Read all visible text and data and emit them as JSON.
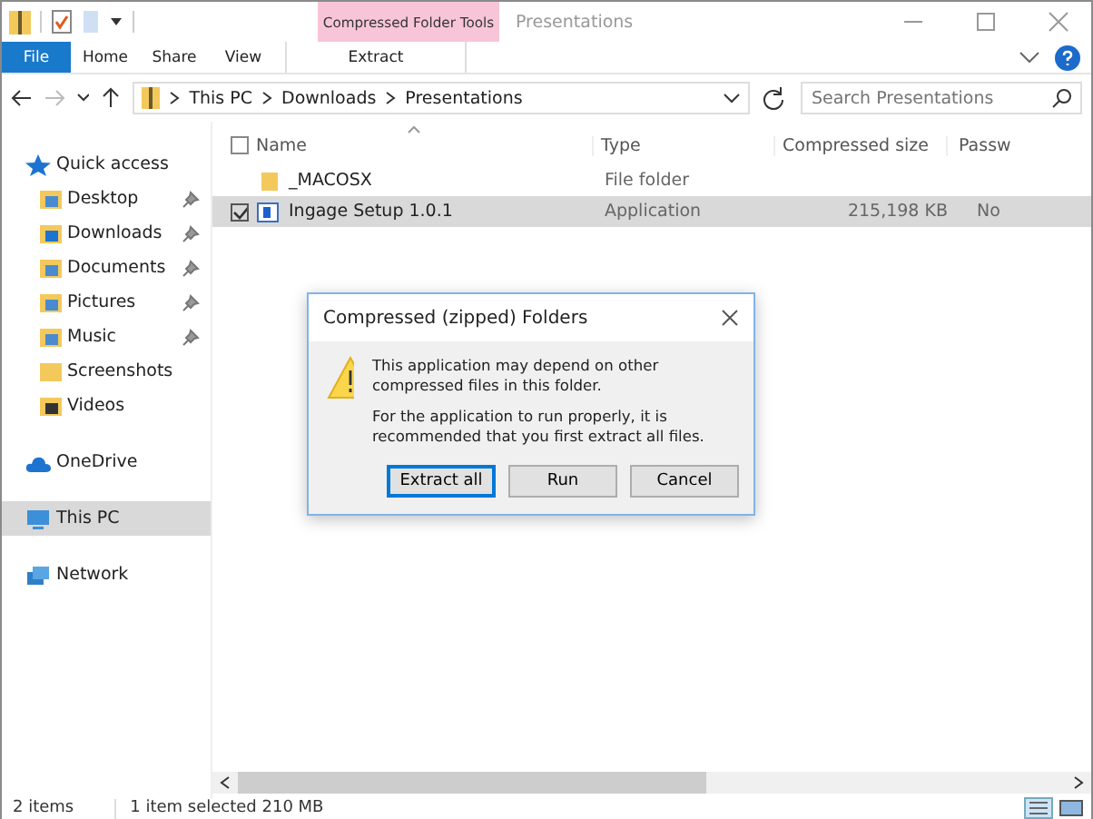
{
  "title_bar": {
    "contextual_tab": "Compressed Folder Tools",
    "title": "Presentations"
  },
  "ribbon_tabs": [
    {
      "label": "File",
      "kind": "file"
    },
    {
      "label": "Home",
      "kind": "tab"
    },
    {
      "label": "Share",
      "kind": "tab"
    },
    {
      "label": "View",
      "kind": "tab"
    },
    {
      "label": "Extract",
      "kind": "contextual"
    }
  ],
  "address": {
    "path": [
      "This PC",
      "Downloads",
      "Presentations"
    ],
    "search_placeholder": "Search Presentations"
  },
  "sidebar": {
    "items": [
      {
        "label": "Quick access",
        "selected": false,
        "kind": "star",
        "children": [
          {
            "label": "Desktop",
            "pinned": true,
            "kind": "desktop"
          },
          {
            "label": "Downloads",
            "pinned": true,
            "kind": "download"
          },
          {
            "label": "Documents",
            "pinned": true,
            "kind": "doc"
          },
          {
            "label": "Pictures",
            "pinned": true,
            "kind": "pic"
          },
          {
            "label": "Music",
            "pinned": true,
            "kind": "music"
          },
          {
            "label": "Screenshots",
            "pinned": false,
            "kind": "folder"
          },
          {
            "label": "Videos",
            "pinned": false,
            "kind": "video"
          }
        ]
      },
      {
        "label": "OneDrive",
        "selected": false,
        "kind": "cloud"
      },
      {
        "label": "This PC",
        "selected": true,
        "kind": "pc"
      },
      {
        "label": "Network",
        "selected": false,
        "kind": "network"
      }
    ]
  },
  "table": {
    "select_all_checked": false,
    "columns": [
      "Name",
      "Type",
      "Compressed size",
      "Passw"
    ],
    "rows": [
      {
        "name": "_MACOSX",
        "kind": "folder",
        "type": "File folder",
        "selected": false,
        "checked": false
      },
      {
        "name": "Ingage Setup 1.0.1",
        "kind": "app",
        "type": "Application",
        "size": "215,198 KB",
        "column_4": "No",
        "selected": true,
        "checked": true
      }
    ]
  },
  "dialog": {
    "title": "Compressed (zipped) Folders",
    "messages": [
      "This application may depend on other compressed files in this folder.",
      "For the application to run properly, it is recommended that you first extract all files."
    ],
    "buttons": [
      {
        "label": "Extract all",
        "default": true
      },
      {
        "label": "Run",
        "default": false
      },
      {
        "label": "Cancel",
        "default": false
      }
    ]
  },
  "status_bar": {
    "count": "2 items",
    "selection": "1 item selected  210 MB"
  }
}
